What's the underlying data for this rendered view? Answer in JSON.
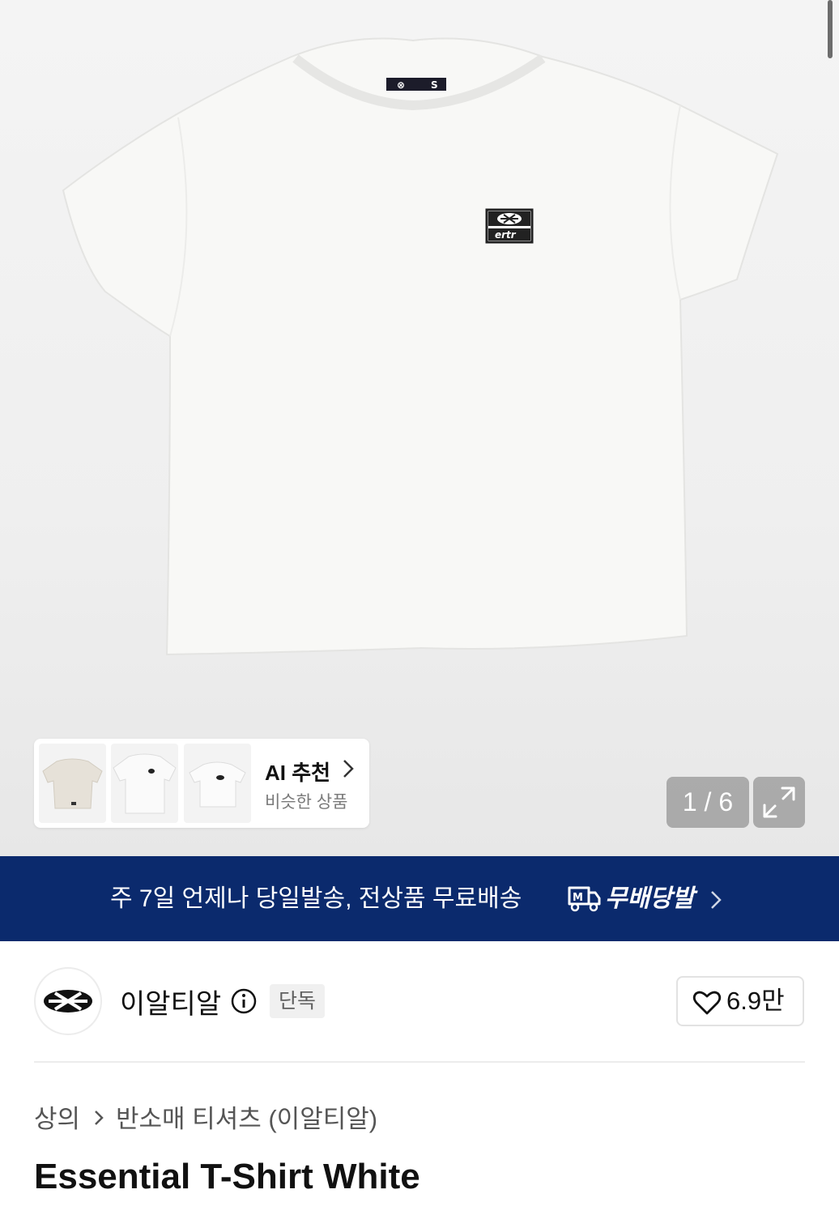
{
  "gallery": {
    "counter": "1 / 6",
    "ai_recommend": {
      "title": "AI 추천",
      "subtitle": "비슷한 상품"
    }
  },
  "banner": {
    "text": "주 7일 언제나 당일발송, 전상품 무료배송",
    "label": "무배당발",
    "color": "#0b2a6d"
  },
  "brand": {
    "name": "이알티알",
    "badge": "단독",
    "likes": "6.9만"
  },
  "breadcrumb": {
    "items": [
      "상의",
      "반소매 티셔츠 (이알티알)"
    ]
  },
  "product": {
    "title": "Essential T-Shirt White"
  },
  "icons": {
    "info": "info-icon",
    "heart": "heart-icon",
    "expand": "expand-icon",
    "chevron": "chevron-right-icon",
    "delivery": "delivery-truck-icon"
  }
}
